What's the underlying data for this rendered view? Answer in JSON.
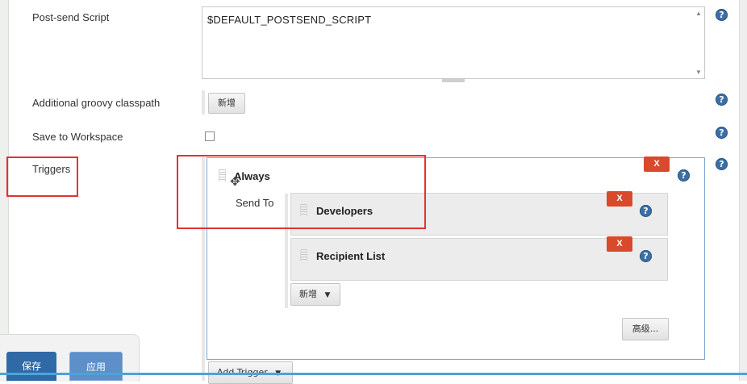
{
  "fields": {
    "postsend_label": "Post-send Script",
    "postsend_value": "$DEFAULT_POSTSEND_SCRIPT",
    "groovy_label": "Additional groovy classpath",
    "groovy_add": "新增",
    "workspace_label": "Save to Workspace",
    "workspace_checked": false,
    "triggers_label": "Triggers"
  },
  "help_glyph": "?",
  "trigger": {
    "name": "Always",
    "send_to_label": "Send To",
    "delete_label": "X",
    "recipients": [
      {
        "name": "Developers",
        "delete_label": "X"
      },
      {
        "name": "Recipient List",
        "delete_label": "X"
      }
    ],
    "add_label": "新增",
    "advanced_label": "高级...",
    "add_trigger_label": "Add Trigger"
  },
  "footer": {
    "save_label": "保存",
    "apply_label": "应用"
  },
  "colors": {
    "accent": "#2f6aa6",
    "delete": "#d9492b",
    "annotation": "#e5322f",
    "help": "#3b6fa6"
  }
}
